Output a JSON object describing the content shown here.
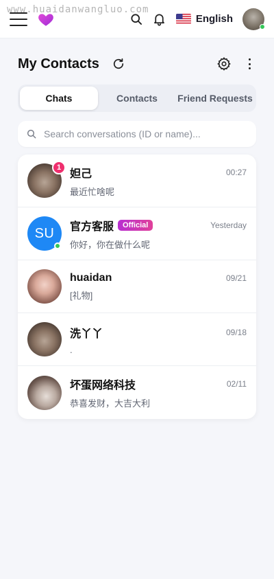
{
  "watermark": "www.huaidanwangluo.com",
  "header": {
    "language": "English"
  },
  "page": {
    "title": "My Contacts"
  },
  "tabs": [
    {
      "label": "Chats",
      "active": true
    },
    {
      "label": "Contacts",
      "active": false
    },
    {
      "label": "Friend Requests",
      "active": false
    }
  ],
  "search": {
    "placeholder": "Search conversations (ID or name)..."
  },
  "chats": [
    {
      "name": "妲己",
      "time": "00:27",
      "message": "最近忙啥呢",
      "unread": "1"
    },
    {
      "name": "官方客服",
      "badge": "Official",
      "time": "Yesterday",
      "message": "你好，你在做什么呢",
      "avatar_text": "SU"
    },
    {
      "name": "huaidan",
      "time": "09/21",
      "message": "[礼物]"
    },
    {
      "name": "洗丫丫",
      "time": "09/18",
      "message": "."
    },
    {
      "name": "坏蛋网络科技",
      "time": "02/11",
      "message": "恭喜发财，大吉大利"
    }
  ],
  "colors": {
    "accent_official": "#c026d3",
    "unread_badge": "#ef2f6e",
    "online": "#35c759",
    "su_avatar": "#1e88f5",
    "logo": "#c23bd4"
  },
  "icons": [
    "menu-icon",
    "heart-logo-icon",
    "search-icon",
    "bell-icon",
    "us-flag-icon",
    "refresh-icon",
    "gear-icon",
    "more-vertical-icon"
  ]
}
